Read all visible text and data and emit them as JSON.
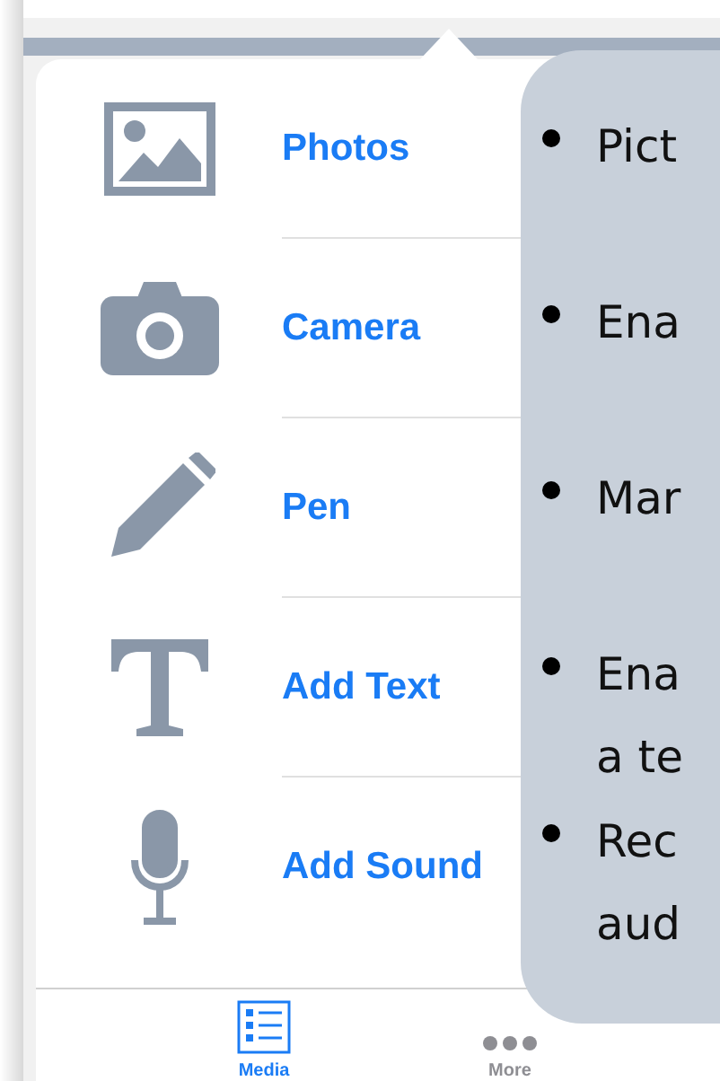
{
  "menu": {
    "items": [
      {
        "kind": "photos",
        "label": "Photos"
      },
      {
        "kind": "camera",
        "label": "Camera"
      },
      {
        "kind": "pen",
        "label": "Pen"
      },
      {
        "kind": "text",
        "label": "Add Text"
      },
      {
        "kind": "sound",
        "label": "Add Sound"
      }
    ]
  },
  "tabs": [
    {
      "kind": "list",
      "label": "Media",
      "selected": true
    },
    {
      "kind": "dots",
      "label": "More",
      "selected": false
    }
  ],
  "callout": {
    "bullets": [
      {
        "lines": [
          "Pict"
        ]
      },
      {
        "lines": [
          "Ena"
        ]
      },
      {
        "lines": [
          "Mar"
        ]
      },
      {
        "lines": [
          "Ena",
          "a te"
        ]
      },
      {
        "lines": [
          "Rec",
          "aud"
        ]
      }
    ]
  }
}
